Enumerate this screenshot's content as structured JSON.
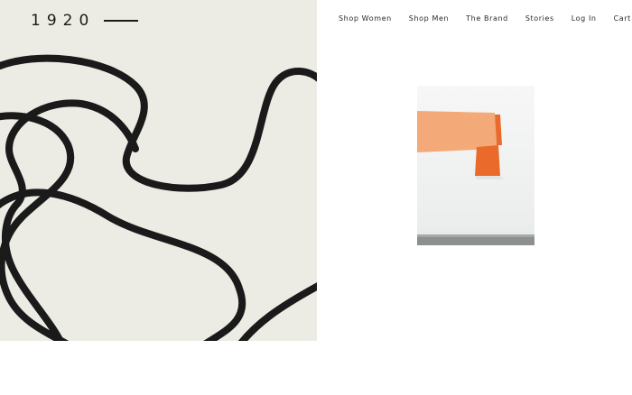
{
  "brand": {
    "logo_text": "1920"
  },
  "nav": {
    "items": [
      {
        "label": "Shop Women",
        "name": "nav-shop-women"
      },
      {
        "label": "Shop Men",
        "name": "nav-shop-men"
      },
      {
        "label": "The Brand",
        "name": "nav-the-brand"
      },
      {
        "label": "Stories",
        "name": "nav-stories"
      },
      {
        "label": "Log In",
        "name": "nav-log-in"
      },
      {
        "label": "Cart",
        "name": "nav-cart"
      }
    ]
  },
  "colors": {
    "hero_background": "#edece4",
    "line_art": "#1a1a1a",
    "product_orange_light": "#f4a978",
    "product_orange_dark": "#ea6a2c"
  }
}
